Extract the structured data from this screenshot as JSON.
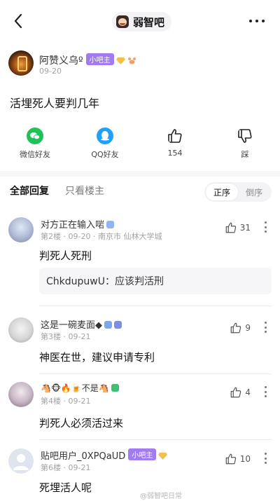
{
  "nav": {
    "forum_name": "弱智吧"
  },
  "post": {
    "author": "阿赞义乌º",
    "author_badge": "小吧主",
    "date": "09-20",
    "title": "活埋死人要判几年"
  },
  "actions": {
    "wechat": "微信好友",
    "qq": "QQ好友",
    "likes": "154",
    "dislike": "踩"
  },
  "tabs": {
    "all": "全部回复",
    "owner_only": "只看楼主",
    "sort_asc": "正序",
    "sort_desc": "倒序"
  },
  "comments": [
    {
      "name": "对方正在输入啱",
      "floor": "第2楼",
      "date": "09-20",
      "location": "南京市 仙林大学城",
      "likes": "31",
      "text": "判死人死刑",
      "reply": "ChkdupuwU：应该判活刑"
    },
    {
      "name": "这是一碗麦面◆",
      "floor": "第3楼",
      "date": "09-21",
      "likes": "9",
      "text": "神医在世，建议申请专利"
    },
    {
      "name": "🐴🐵🔥🍺不是🐴",
      "floor": "第4楼",
      "date": "09-21",
      "likes": "4",
      "text": "判死人必须活过来"
    },
    {
      "name": "贴吧用户_0XPQaUD",
      "badge": "小吧主",
      "floor": "第6楼",
      "date": "09-21",
      "likes": "10",
      "text": "死埋活人呢"
    }
  ],
  "watermark": "@弱智吧日常",
  "colors": {
    "mod_badge": "#a27bf0",
    "wechat": "#21c15a",
    "qq": "#1ea1f7"
  }
}
